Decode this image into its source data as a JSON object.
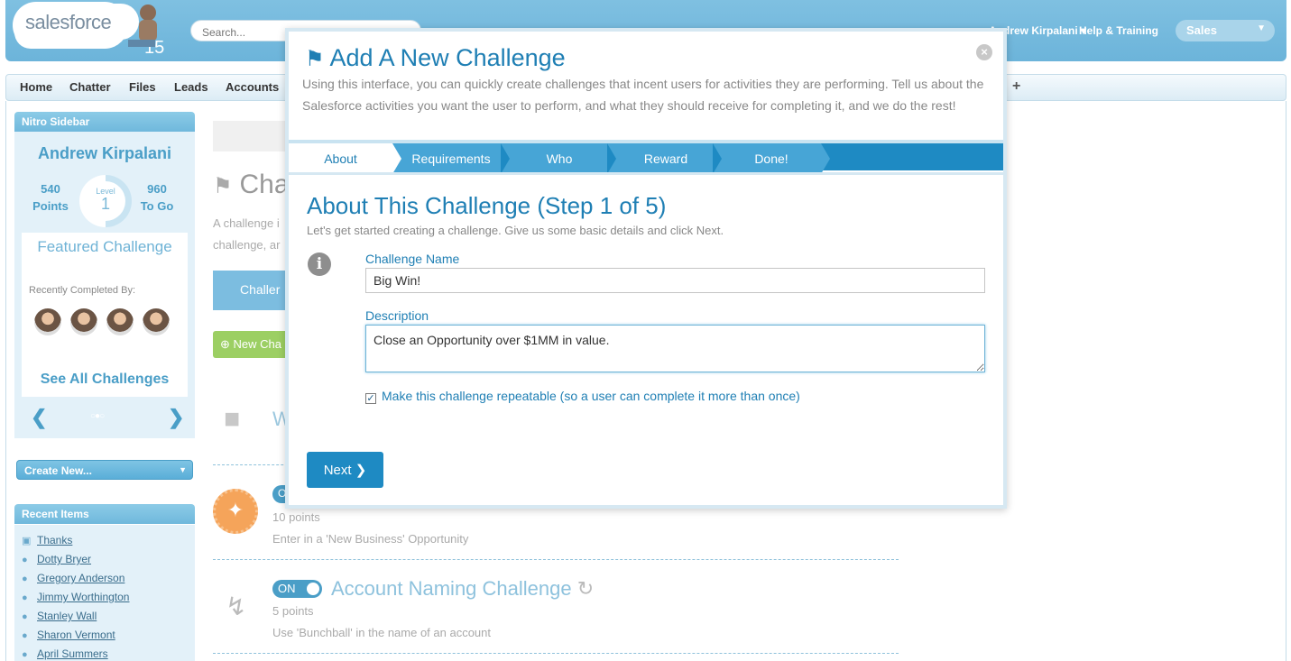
{
  "header": {
    "logo_text": "salesforce",
    "logo_number": "15",
    "search_placeholder": "Search...",
    "user_name": "Andrew Kirpalani",
    "help_label": "Help & Training",
    "app_label": "Sales"
  },
  "tabs": [
    "Home",
    "Chatter",
    "Files",
    "Leads",
    "Accounts"
  ],
  "sidebar": {
    "nitro_header": "Nitro Sidebar",
    "user_name": "Andrew Kirpalani",
    "points_value": "540",
    "points_label": "Points",
    "level_label": "Level",
    "level_value": "1",
    "to_go_value": "960",
    "to_go_label": "To Go",
    "featured_title": "Featured Challenge",
    "recently_completed": "Recently Completed By:",
    "see_all": "See All Challenges",
    "create_new": "Create New...",
    "recent_header": "Recent Items",
    "recent_items": [
      "Thanks",
      "Dotty Bryer",
      "Gregory Anderson",
      "Jimmy Worthington",
      "Stanley Wall",
      "Sharon Vermont",
      "April Summers"
    ]
  },
  "background": {
    "page_title": "Cha",
    "intro_line1": "A challenge i",
    "intro_line2": "challenge, ar",
    "challenge_tab": "Challer",
    "new_challenge": "New Cha",
    "folder_label": "W",
    "challenge1_points": "10 points",
    "challenge1_desc": "Enter in a 'New Business' Opportunity",
    "challenge2_toggle": "ON",
    "challenge2_name": "Account Naming Challenge",
    "challenge2_points": "5 points",
    "challenge2_desc": "Use 'Bunchball' in the name of an account"
  },
  "modal": {
    "title": "Add A New Challenge",
    "intro": "Using this interface, you can quickly create challenges that incent users for activities they are performing. Tell us about the Salesforce activities you want the user to perform, and what they should receive for completing it, and we do the rest!",
    "steps": [
      "About",
      "Requirements",
      "Who",
      "Reward",
      "Done!"
    ],
    "step_heading": "About This Challenge (Step 1 of 5)",
    "step_sub": "Let's get started creating a challenge. Give us some basic details and click Next.",
    "name_label": "Challenge Name",
    "name_value": "Big Win!",
    "description_label": "Description",
    "description_value": "Close an Opportunity over $1MM in value.",
    "repeatable_label": "Make this challenge repeatable (so a user can complete it more than once)",
    "repeatable_checked": true,
    "next_label": "Next"
  },
  "colors": {
    "header_blue": "#6cb4da",
    "accent_blue": "#1f7fb4",
    "step_bar": "#1e8ac3"
  }
}
